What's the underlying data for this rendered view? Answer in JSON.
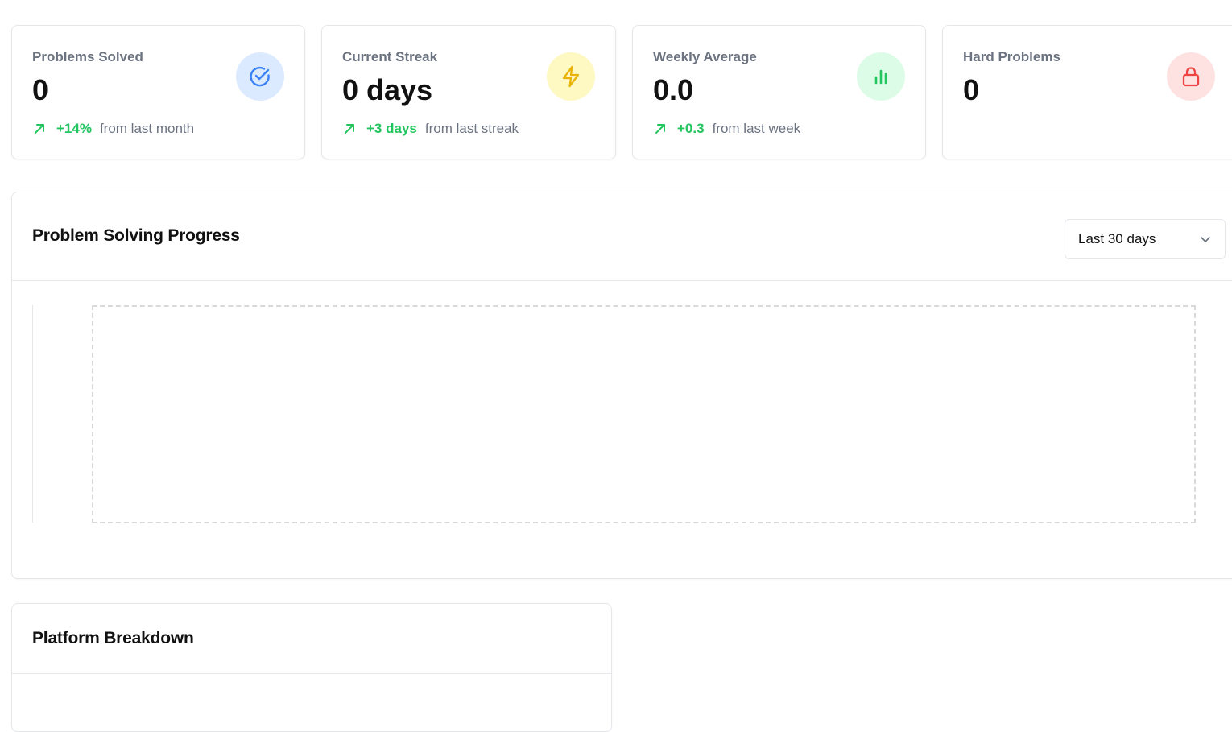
{
  "stats": [
    {
      "label": "Problems Solved",
      "value": "0",
      "change_value": "+14%",
      "change_text": "from last month",
      "icon": "check-circle-icon",
      "icon_color": "#3b82f6",
      "icon_bg": "#dbeafe"
    },
    {
      "label": "Current Streak",
      "value": "0 days",
      "change_value": "+3 days",
      "change_text": "from last streak",
      "icon": "lightning-icon",
      "icon_color": "#eab308",
      "icon_bg": "#fef9c3"
    },
    {
      "label": "Weekly Average",
      "value": "0.0",
      "change_value": "+0.3",
      "change_text": "from last week",
      "icon": "bar-chart-icon",
      "icon_color": "#22c55e",
      "icon_bg": "#dcfce7"
    },
    {
      "label": "Hard Problems",
      "value": "0",
      "icon": "lock-icon",
      "icon_color": "#ef4444",
      "icon_bg": "#fee2e2"
    }
  ],
  "progress_panel": {
    "title": "Problem Solving Progress",
    "range_selected": "Last 30 days"
  },
  "platform_panel": {
    "title": "Platform Breakdown"
  },
  "colors": {
    "positive": "#22c55e",
    "muted_text": "#6b7280",
    "border": "#e5e7eb"
  }
}
